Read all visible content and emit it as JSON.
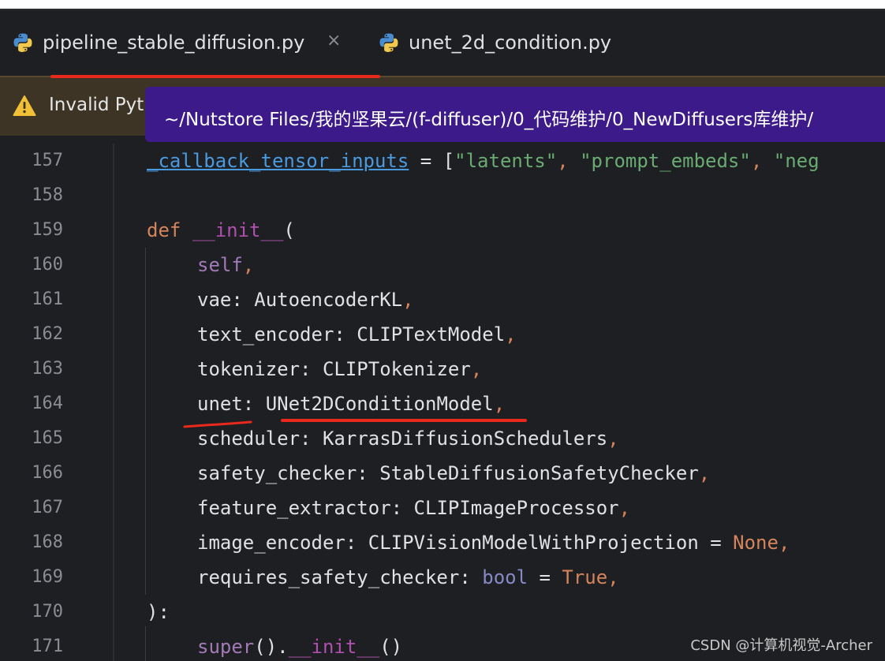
{
  "tabs": [
    {
      "label": "pipeline_stable_diffusion.py",
      "active": true,
      "icon": "python-icon"
    },
    {
      "label": "unet_2d_condition.py",
      "active": false,
      "icon": "python-icon"
    }
  ],
  "tab_close_glyph": "×",
  "warning": {
    "text": "Invalid Pyt",
    "icon": "warning-icon"
  },
  "tooltip": {
    "path": "~/Nutstore Files/我的坚果云/(f-diffuser)/0_代码维护/0_NewDiffusers库维护/"
  },
  "colors": {
    "accent_tab_underline": "#3fd7f0",
    "annotation_red": "#e8291c",
    "tooltip_bg": "#3d1a8a",
    "warning_bg": "#3d3426"
  },
  "code_lines": [
    {
      "n": "157"
    },
    {
      "n": "158"
    },
    {
      "n": "159"
    },
    {
      "n": "160"
    },
    {
      "n": "161"
    },
    {
      "n": "162"
    },
    {
      "n": "163"
    },
    {
      "n": "164"
    },
    {
      "n": "165"
    },
    {
      "n": "166"
    },
    {
      "n": "167"
    },
    {
      "n": "168"
    },
    {
      "n": "169"
    },
    {
      "n": "170"
    },
    {
      "n": "171"
    }
  ],
  "code": {
    "l157": {
      "name": "_callback_tensor_inputs",
      "eq": " = [",
      "s1": "\"latents\"",
      "c1": ", ",
      "s2": "\"prompt_embeds\"",
      "c2": ", ",
      "s3": "\"neg"
    },
    "l159": {
      "kw": "def",
      "sp": " ",
      "fn": "__init__",
      "paren": "("
    },
    "l160": {
      "self": "self",
      "comma": ","
    },
    "l161": {
      "param": "vae",
      "colon": ": ",
      "type": "AutoencoderKL",
      "comma": ","
    },
    "l162": {
      "param": "text_encoder",
      "colon": ": ",
      "type": "CLIPTextModel",
      "comma": ","
    },
    "l163": {
      "param": "tokenizer",
      "colon": ": ",
      "type": "CLIPTokenizer",
      "comma": ","
    },
    "l164": {
      "param": "unet",
      "colon": ": ",
      "type": "UNet2DConditionModel",
      "comma": ","
    },
    "l165": {
      "param": "scheduler",
      "colon": ": ",
      "type": "KarrasDiffusionSchedulers",
      "comma": ","
    },
    "l166": {
      "param": "safety_checker",
      "colon": ": ",
      "type": "StableDiffusionSafetyChecker",
      "comma": ","
    },
    "l167": {
      "param": "feature_extractor",
      "colon": ": ",
      "type": "CLIPImageProcessor",
      "comma": ","
    },
    "l168": {
      "param": "image_encoder",
      "colon": ": ",
      "type": "CLIPVisionModelWithProjection",
      "eq": " = ",
      "val": "None",
      "comma": ","
    },
    "l169": {
      "param": "requires_safety_checker",
      "colon": ": ",
      "type": "bool",
      "eq": " = ",
      "val": "True",
      "comma": ","
    },
    "l170": {
      "text": "):"
    },
    "l171": {
      "fn": "super",
      "call": "().",
      "magic": "__init__",
      "end": "()"
    }
  },
  "watermark": "CSDN @计算机视觉-Archer"
}
